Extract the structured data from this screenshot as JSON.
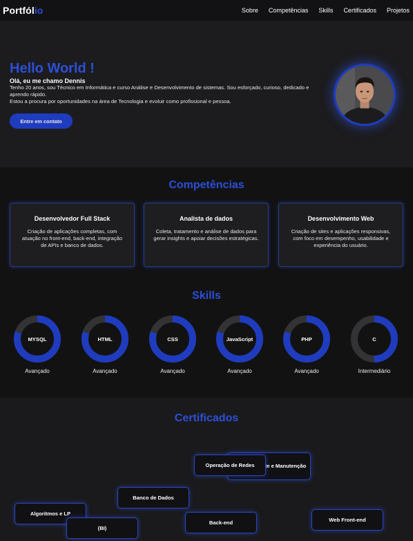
{
  "nav": {
    "logo_main": "Portfól",
    "logo_accent": "io",
    "links": [
      "Sobre",
      "Competências",
      "Skills",
      "Certificados",
      "Projetos"
    ]
  },
  "hero": {
    "title": "Hello World !",
    "subtitle": "Olá, eu me chamo Dennis",
    "lines": [
      "Tenho 20 anos, sou Técnico em Informática e curso Análise e Desenvolvimento de sistemas. Sou esforçado, curioso, dedicado e aprendo rápido.",
      "Estou a procura por oportunidades na área de Tecnologia e evoluir como profissional e pessoa."
    ],
    "button": "Entre em contato"
  },
  "competencias": {
    "title": "Competências",
    "cards": [
      {
        "title": "Desenvolvedor Full Stack",
        "desc": "Criação de aplicações completas, com atuação no front-end, back-end, integração de APIs e banco de dados."
      },
      {
        "title": "Analista de dados",
        "desc": "Coleta, tratamento e análise de dados para gerar insights e apoiar decisões estratégicas."
      },
      {
        "title": "Desenvolvimento Web",
        "desc": "Criação de sites e aplicações responsivas, com foco em desempenho, usabilidade e experiência do usuário."
      }
    ]
  },
  "skills": {
    "title": "Skills",
    "items": [
      {
        "name": "MYSQL",
        "level": "Avançado",
        "progress": 0.8
      },
      {
        "name": "HTML",
        "level": "Avançado",
        "progress": 0.8
      },
      {
        "name": "CSS",
        "level": "Avançado",
        "progress": 0.8
      },
      {
        "name": "JavaScript",
        "level": "Avançado",
        "progress": 0.8
      },
      {
        "name": "PHP",
        "level": "Avançado",
        "progress": 0.8
      },
      {
        "name": "C",
        "level": "Intermediário",
        "progress": 0.5
      }
    ]
  },
  "certificados": {
    "title": "Certificados",
    "items": [
      "Suporte e Manutenção",
      "Operação de Redes",
      "Banco de Dados",
      "Algoritmos e LP",
      "(BI)",
      "Back-end",
      "Web Front-end"
    ]
  },
  "colors": {
    "accent": "#2d4fd6",
    "ring_track": "#333336",
    "ring_fill": "#1f3cbf"
  }
}
